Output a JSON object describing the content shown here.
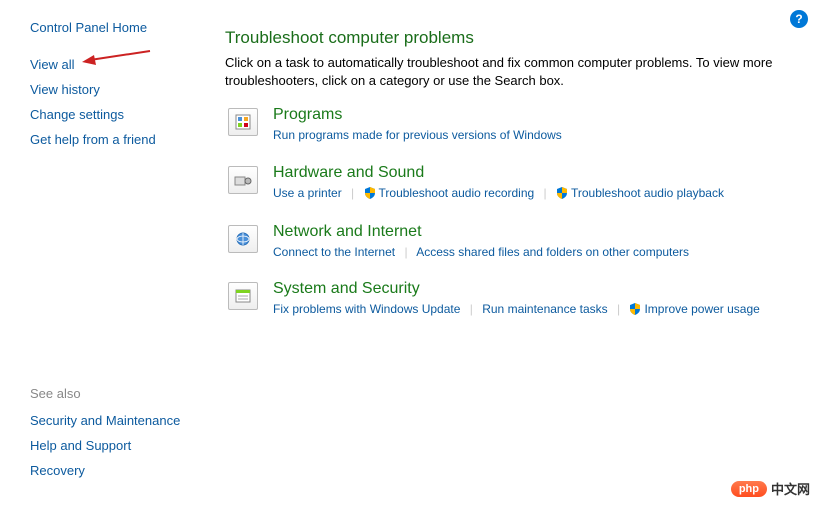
{
  "help_icon": "?",
  "sidebar": {
    "home": "Control Panel Home",
    "links": [
      "View all",
      "View history",
      "Change settings",
      "Get help from a friend"
    ],
    "see_also_header": "See also",
    "see_also": [
      "Security and Maintenance",
      "Help and Support",
      "Recovery"
    ]
  },
  "main": {
    "title": "Troubleshoot computer problems",
    "description": "Click on a task to automatically troubleshoot and fix common computer problems. To view more troubleshooters, click on a category or use the Search box."
  },
  "categories": [
    {
      "title": "Programs",
      "links": [
        {
          "label": "Run programs made for previous versions of Windows",
          "shield": false
        }
      ]
    },
    {
      "title": "Hardware and Sound",
      "links": [
        {
          "label": "Use a printer",
          "shield": false
        },
        {
          "label": "Troubleshoot audio recording",
          "shield": true
        },
        {
          "label": "Troubleshoot audio playback",
          "shield": true
        }
      ]
    },
    {
      "title": "Network and Internet",
      "links": [
        {
          "label": "Connect to the Internet",
          "shield": false
        },
        {
          "label": "Access shared files and folders on other computers",
          "shield": false
        }
      ]
    },
    {
      "title": "System and Security",
      "links": [
        {
          "label": "Fix problems with Windows Update",
          "shield": false
        },
        {
          "label": "Run maintenance tasks",
          "shield": false
        },
        {
          "label": "Improve power usage",
          "shield": true
        }
      ]
    }
  ],
  "watermark": {
    "badge": "php",
    "text": "中文网"
  }
}
